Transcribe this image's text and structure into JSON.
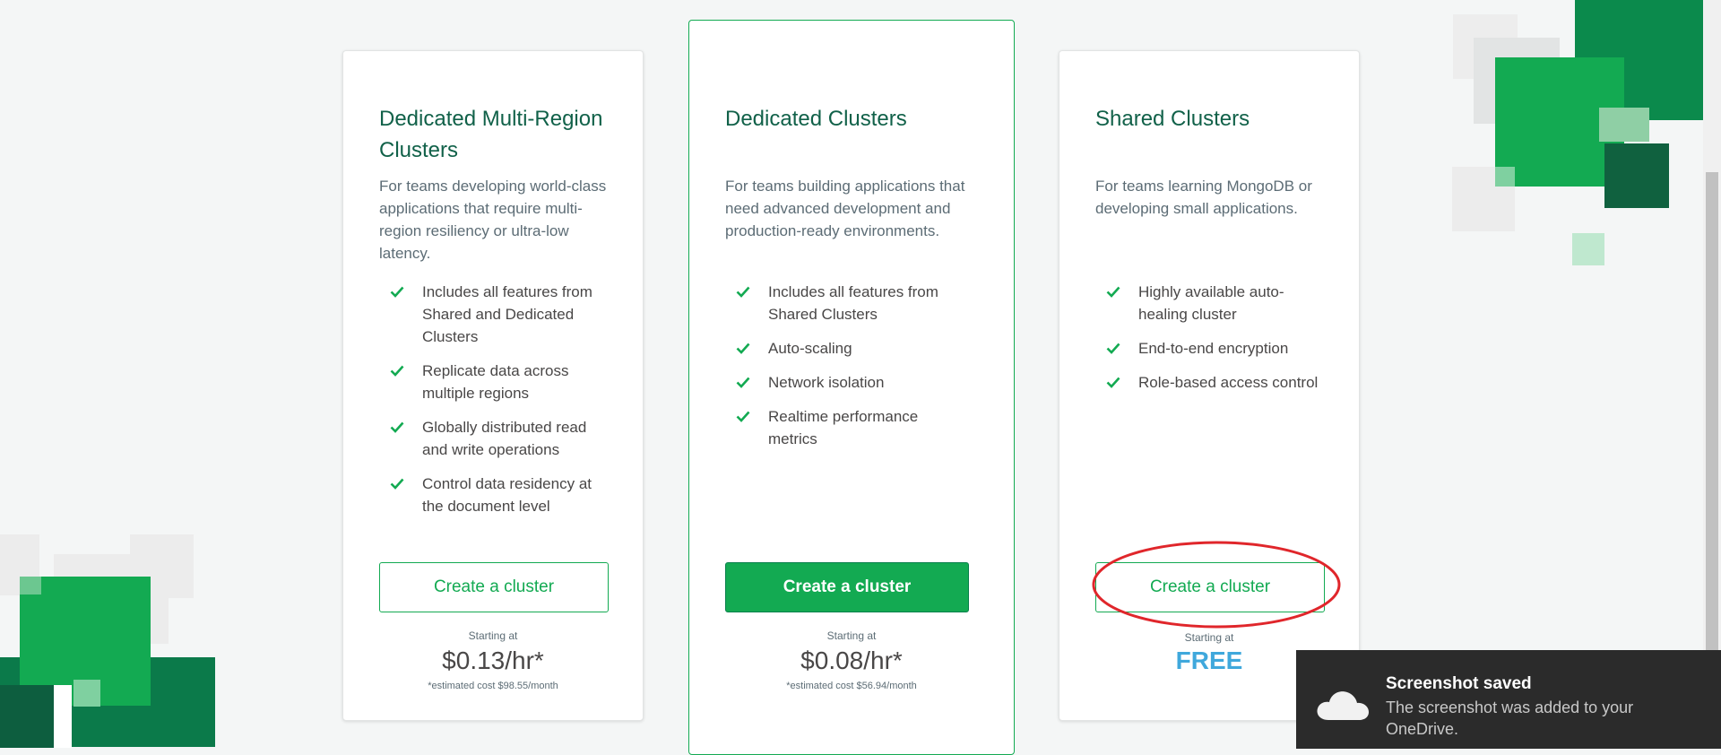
{
  "colors": {
    "brand_green": "#13aa52",
    "dark_green": "#116149",
    "price_free": "#3fa8dc",
    "annotation_red": "#e0262b",
    "toast_bg": "#2b2b2b"
  },
  "plans": [
    {
      "title": "Dedicated Multi-Region Clusters",
      "description": "For teams developing world-class applications that require multi-region resiliency or ultra-low latency.",
      "features": [
        "Includes all features from Shared and Dedicated Clusters",
        "Replicate data across multiple regions",
        "Globally distributed read and write operations",
        "Control data residency at the document level"
      ],
      "button_label": "Create a cluster",
      "starting_label": "Starting at",
      "price": "$0.13/hr*",
      "estimate": "*estimated cost $98.55/month"
    },
    {
      "title": "Dedicated Clusters",
      "description": "For teams building applications that need advanced development and production-ready environments.",
      "features": [
        "Includes all features from Shared Clusters",
        "Auto-scaling",
        "Network isolation",
        "Realtime performance metrics"
      ],
      "button_label": "Create a cluster",
      "starting_label": "Starting at",
      "price": "$0.08/hr*",
      "estimate": "*estimated cost $56.94/month"
    },
    {
      "title": "Shared Clusters",
      "description": "For teams learning MongoDB or developing small applications.",
      "features": [
        "Highly available auto-healing cluster",
        "End-to-end encryption",
        "Role-based access control"
      ],
      "button_label": "Create a cluster",
      "starting_label": "Starting at",
      "price": "FREE"
    }
  ],
  "toast": {
    "title": "Screenshot saved",
    "message": "The screenshot was added to your OneDrive.",
    "icon": "onedrive-cloud-icon"
  }
}
